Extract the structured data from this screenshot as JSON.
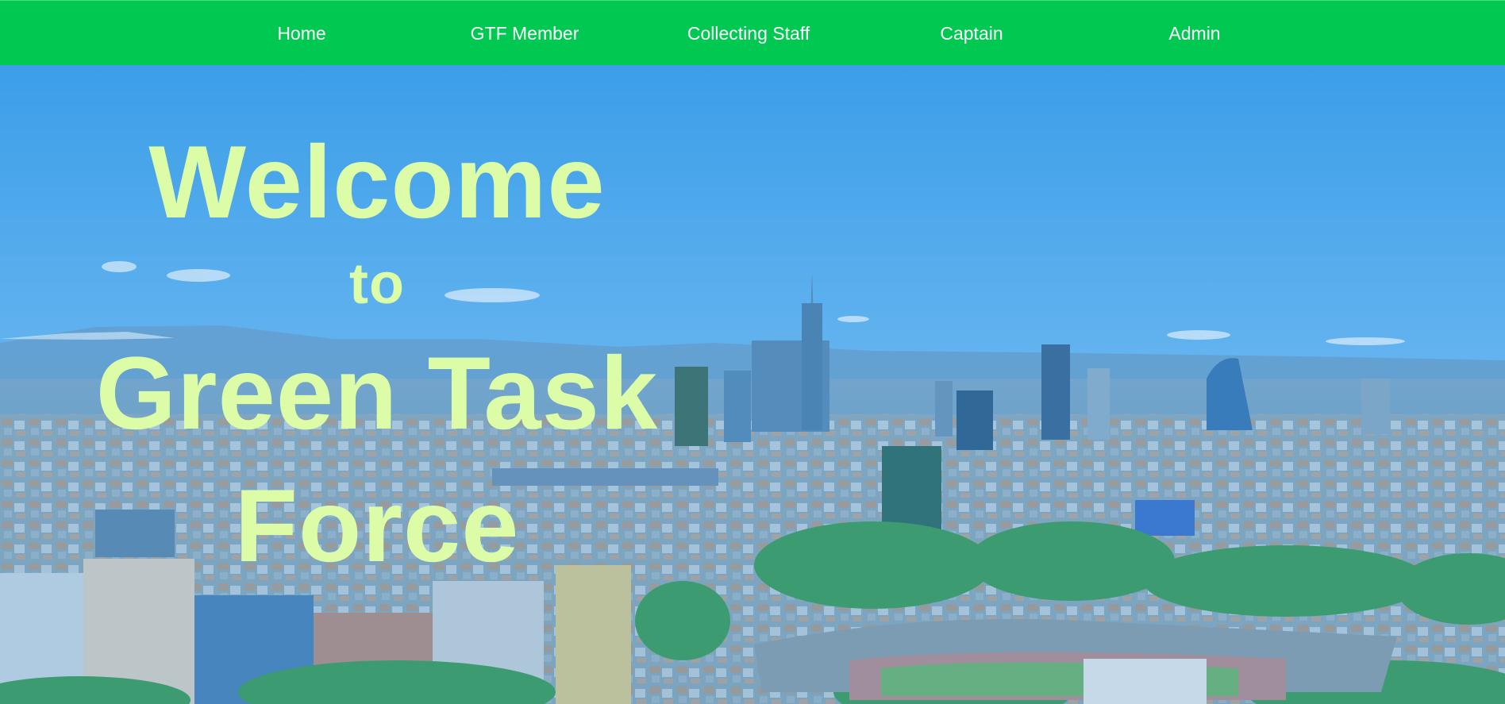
{
  "nav": {
    "items": [
      {
        "label": "Home"
      },
      {
        "label": "GTF Member"
      },
      {
        "label": "Collecting Staff"
      },
      {
        "label": "Captain"
      },
      {
        "label": "Admin"
      }
    ]
  },
  "hero": {
    "line1": "Welcome",
    "line2": "to",
    "line3": "Green Task",
    "line4": "Force",
    "background": "city-skyline-photo"
  },
  "colors": {
    "navbar": "#00c851",
    "nav_text": "#ffffff",
    "headline": "#dcfca8",
    "sky": "#4aa8ee"
  }
}
